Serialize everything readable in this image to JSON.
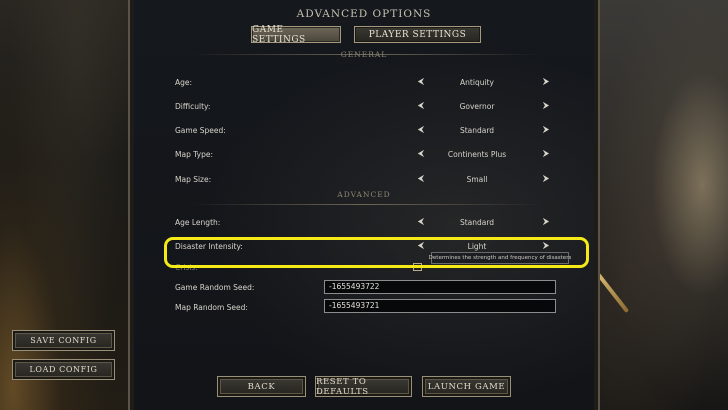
{
  "title": "ADVANCED OPTIONS",
  "tabs": {
    "game": "GAME SETTINGS",
    "player": "PLAYER SETTINGS"
  },
  "sections": {
    "general": "GENERAL",
    "advanced": "ADVANCED"
  },
  "arrows": {
    "prev": "⮜",
    "next": "⮞"
  },
  "general": [
    {
      "label": "Age:",
      "value": "Antiquity"
    },
    {
      "label": "Difficulty:",
      "value": "Governor"
    },
    {
      "label": "Game Speed:",
      "value": "Standard"
    },
    {
      "label": "Map Type:",
      "value": "Continents Plus"
    },
    {
      "label": "Map Size:",
      "value": "Small"
    }
  ],
  "advanced": [
    {
      "label": "Age Length:",
      "value": "Standard"
    },
    {
      "label": "Disaster Intensity:",
      "value": "Light"
    }
  ],
  "tooltip": "Determines the strength and frequency of disasters",
  "obscured_label": "Crisis:",
  "seeds": {
    "game_label": "Game Random Seed:",
    "game_value": "-1655493722",
    "map_label": "Map Random Seed:",
    "map_value": "-1655493721"
  },
  "buttons": {
    "back": "BACK",
    "reset": "RESET TO DEFAULTS",
    "launch": "LAUNCH GAME",
    "save": "SAVE CONFIG",
    "load": "LOAD CONFIG"
  },
  "colors": {
    "highlight": "#f5ea18",
    "accent": "#a59a80"
  }
}
